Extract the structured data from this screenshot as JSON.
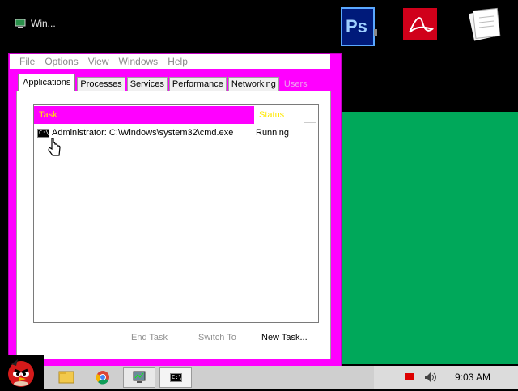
{
  "desktop": {
    "window_title": "Win...",
    "icons": [
      "photoshop-icon",
      "acrobat-icon",
      "document-icon"
    ],
    "bg_color": "#00a85a"
  },
  "task_manager": {
    "menu": [
      "File",
      "Options",
      "View",
      "Windows",
      "Help"
    ],
    "tabs": [
      "Applications",
      "Processes",
      "Services",
      "Performance",
      "Networking",
      "Users"
    ],
    "active_tab": "Applications",
    "columns": {
      "task": "Task",
      "status": "Status"
    },
    "rows": [
      {
        "task": "Administrator: C:\\Windows\\system32\\cmd.exe",
        "status": "Running",
        "icon": "cmd-icon"
      }
    ],
    "buttons": {
      "end_task": "End Task",
      "switch_to": "Switch To",
      "new_task": "New Task..."
    },
    "accent": "#ff00ff",
    "header_text_color": "#ffe800"
  },
  "taskbar": {
    "clock": "9:03 AM",
    "apps": [
      "angry-birds-icon",
      "explorer-icon",
      "chrome-icon",
      "task-manager-icon",
      "cmd-icon"
    ],
    "cmd_icon_text": "C:\\"
  }
}
